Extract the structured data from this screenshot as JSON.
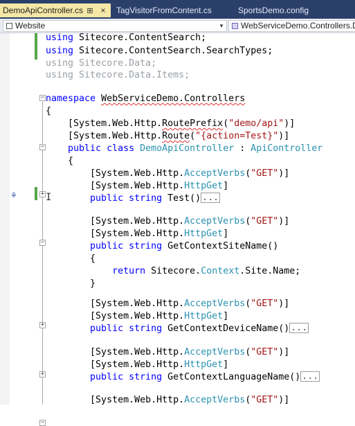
{
  "tabs": [
    {
      "label": "DemoApiController.cs",
      "active": true
    },
    {
      "label": "TagVisitorFromContent.cs",
      "active": false
    },
    {
      "label": "SportsDemo.config",
      "active": false
    }
  ],
  "navbar": {
    "project": "Website",
    "type_path": "WebServiceDemo.Controllers.De"
  },
  "colors": {
    "tab_strip": "#2b3f6b",
    "active_tab": "#f5e8a6",
    "keyword": "#0000ff",
    "type": "#2b91af",
    "string": "#a31515",
    "change_bar": "#57a64a"
  },
  "code": {
    "line1_a": "using ",
    "line1_b": "Sitecore.ContentSearch;",
    "line2_a": "using ",
    "line2_b": "Sitecore.ContentSearch.SearchTypes;",
    "line3_a": "using ",
    "line3_b": "Sitecore.Data;",
    "line4_a": "using ",
    "line4_b": "Sitecore.Data.Items;",
    "ns_kw": "namespace ",
    "ns_name": "WebServiceDemo.Controllers",
    "brace_open": "{",
    "brace_close": "}",
    "attr_prefix": "[System.Web.Http.",
    "route_prefix": "RoutePrefix",
    "route_prefix_arg": "\"demo/api\"",
    "route": "Route",
    "route_arg": "\"{action=Test}\"",
    "paren_open": "(",
    "paren_close_bracket": ")]",
    "bracket_close": "]",
    "public_class": "public class ",
    "class_name": "DemoApiController",
    "colon": " : ",
    "base_class": "ApiController",
    "accept_verbs": "AcceptVerbs",
    "get_arg": "\"GET\"",
    "http_get": "HttpGet",
    "public_string": "public string ",
    "method_test": "Test",
    "parens": "()",
    "method_site": "GetContextSiteName",
    "return_kw": "return ",
    "return_a": "Sitecore.",
    "return_ctx": "Context",
    "return_b": ".Site.Name;",
    "method_device": "GetContextDeviceName",
    "method_language": "GetContextLanguageName",
    "ellipsis": "...",
    "fold_minus": "−",
    "fold_plus": "+"
  },
  "icons": {
    "quick_action": "quick-action-icon",
    "quick_action_glyph": "⚘",
    "cursor_glyph": "I",
    "tab_close": "×",
    "tab_pin": "⊞",
    "dropdown": "▾"
  }
}
